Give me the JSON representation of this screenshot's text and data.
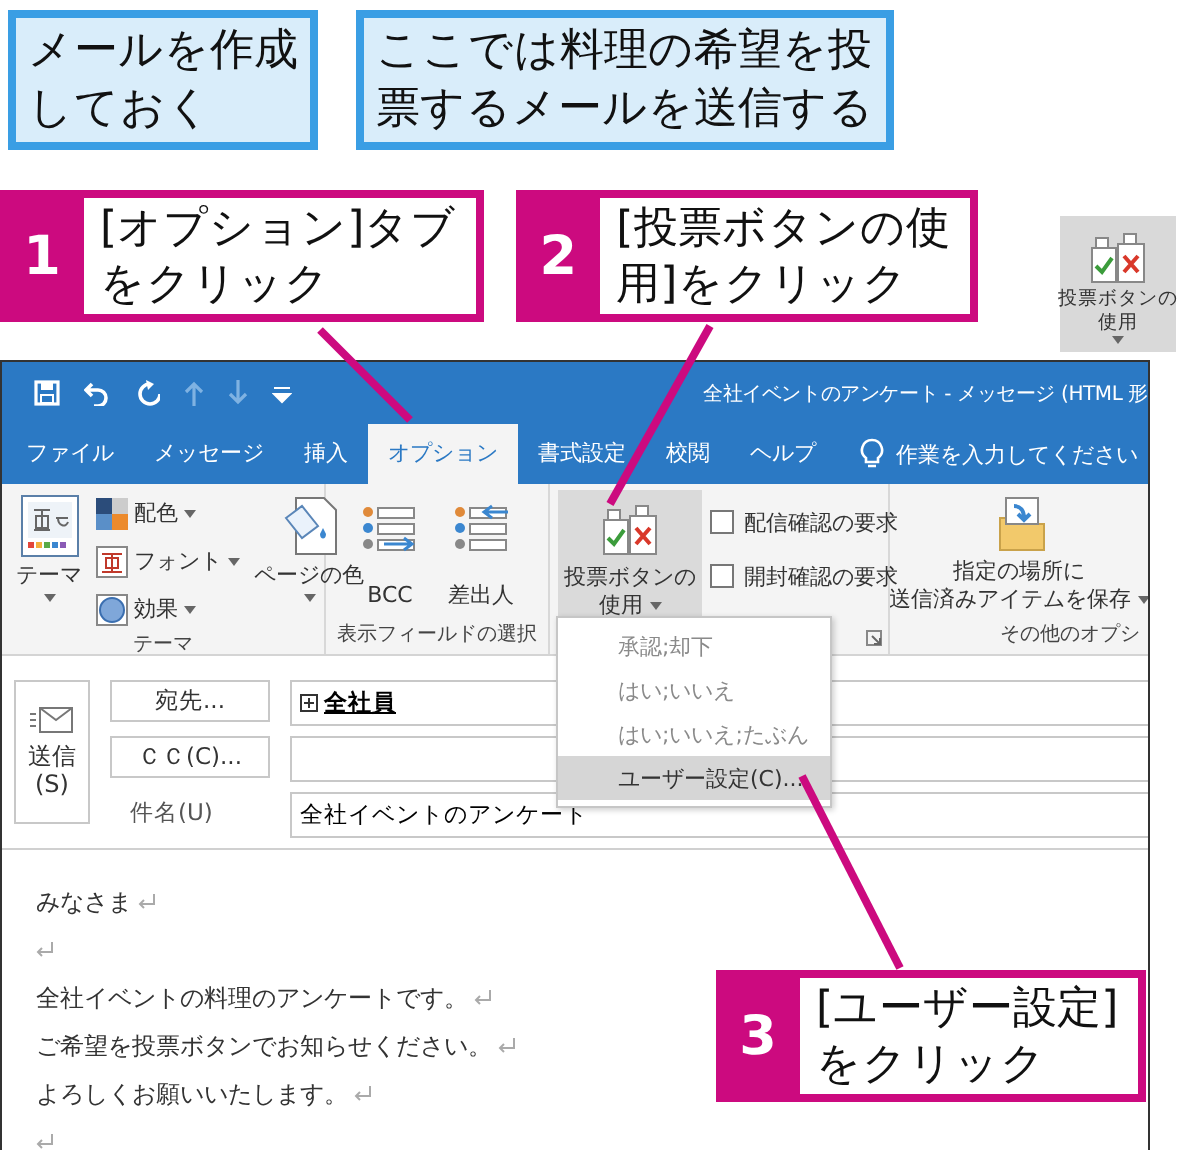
{
  "notes": [
    {
      "lines": [
        "メールを作成",
        "しておく"
      ]
    },
    {
      "lines": [
        "ここでは料理の希望を投",
        "票するメールを送信する"
      ]
    }
  ],
  "callouts": [
    {
      "number": "1",
      "lines": [
        "[オプション]タブ",
        "をクリック"
      ]
    },
    {
      "number": "2",
      "lines": [
        "[投票ボタンの使",
        "用]をクリック"
      ]
    },
    {
      "number": "3",
      "lines": [
        "[ユーザー設定]",
        "をクリック"
      ]
    }
  ],
  "button_preview": {
    "lines": [
      "投票ボタンの",
      "使用"
    ]
  },
  "window": {
    "title": "全社イベントのアンケート - メッセージ (HTML 形"
  },
  "tabs": [
    {
      "label": "ファイル",
      "selected": false
    },
    {
      "label": "メッセージ",
      "selected": false
    },
    {
      "label": "挿入",
      "selected": false
    },
    {
      "label": "オプション",
      "selected": true
    },
    {
      "label": "書式設定",
      "selected": false
    },
    {
      "label": "校閲",
      "selected": false
    },
    {
      "label": "ヘルプ",
      "selected": false
    }
  ],
  "tell_me": "作業を入力してください",
  "ribbon": {
    "theme_group": {
      "label": "テーマ",
      "theme_button": "テーマ",
      "colors": "配色",
      "fonts": "フォント",
      "effects": "効果",
      "page_color": "ページの色"
    },
    "fields_group": {
      "label": "表示フィールドの選択",
      "buttons": [
        "BCC",
        "差出人"
      ]
    },
    "tracking_group": {
      "vote_button": {
        "lines": [
          "投票ボタンの",
          "使用"
        ],
        "pressed": true
      },
      "checkboxes": [
        {
          "label": "配信確認の要求",
          "checked": false
        },
        {
          "label": "開封確認の要求",
          "checked": false
        }
      ]
    },
    "more_group": {
      "save_button": {
        "lines": [
          "指定の場所に",
          "送信済みアイテムを保存"
        ]
      },
      "label": "その他のオプシ"
    }
  },
  "vote_menu": [
    {
      "label": "承認;却下",
      "selected": false
    },
    {
      "label": "はい;いいえ",
      "selected": false
    },
    {
      "label": "はい;いいえ;たぶん",
      "selected": false
    },
    {
      "label": "ユーザー設定(C)...",
      "selected": true
    }
  ],
  "compose": {
    "send": {
      "lines": [
        "送信",
        "(S)"
      ]
    },
    "to_button": "宛先...",
    "to_value": "全社員",
    "cc_button": "ＣＣ(C)...",
    "subject_label": "件名(U)",
    "subject_value": "全社イベントのアンケート"
  },
  "body": [
    {
      "kind": "text",
      "text": "みなさま"
    },
    {
      "kind": "blank"
    },
    {
      "kind": "text",
      "text": "全社イベントの料理のアンケートです。"
    },
    {
      "kind": "text",
      "text": "ご希望を投票ボタンでお知らせください。"
    },
    {
      "kind": "text",
      "text": "よろしくお願いいたします。"
    },
    {
      "kind": "blank"
    }
  ]
}
